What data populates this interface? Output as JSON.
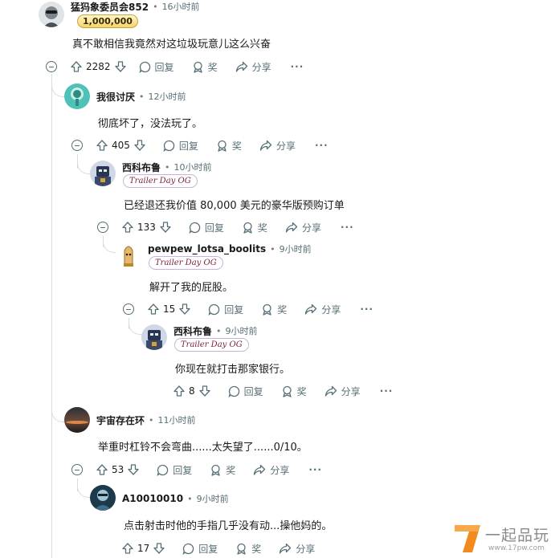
{
  "labels": {
    "reply": "回复",
    "award": "奖",
    "share": "分享",
    "more": "···"
  },
  "comments": [
    {
      "username": "猛犸象委员会852",
      "time": "16小时前",
      "flair": "1,000,000",
      "body": "真不敢相信我竟然对这垃圾玩意儿这么兴奋",
      "votes": "2282"
    },
    {
      "username": "我很讨厌",
      "time": "12小时前",
      "flair": "",
      "body": "彻底坏了，没法玩了。",
      "votes": "405"
    },
    {
      "username": "西科布鲁",
      "time": "10小时前",
      "flair": "Trailer Day OG",
      "body": "已经退还我价值 80,000 美元的豪华版预购订单",
      "votes": "133"
    },
    {
      "username": "pewpew_lotsa_boolits",
      "time": "9小时前",
      "flair": "Trailer Day OG",
      "body": "解开了我的屁股。",
      "votes": "15"
    },
    {
      "username": "西科布鲁",
      "time": "9小时前",
      "flair": "Trailer Day OG",
      "body": "你现在就打击那家银行。",
      "votes": "8"
    },
    {
      "username": "宇宙存在环",
      "time": "11小时前",
      "flair": "",
      "body": "举重时杠铃不会弯曲......太失望了......0/10。",
      "votes": "53"
    },
    {
      "username": "A10010010",
      "time": "9小时前",
      "flair": "",
      "body": "点击射击时他的手指几乎没有动...操他妈的。",
      "votes": "17"
    }
  ],
  "watermark": {
    "text": "一起品玩",
    "url": "www.17pw.com"
  }
}
